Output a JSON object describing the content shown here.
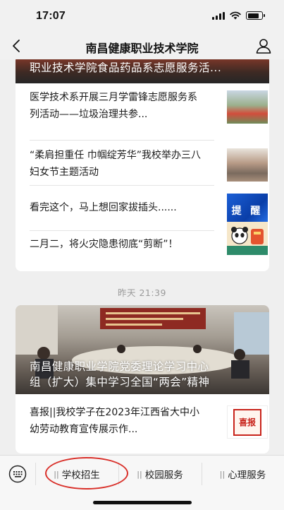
{
  "status_bar": {
    "time": "17:07",
    "battery_level": 0.8
  },
  "nav": {
    "title": "南昌健康职业技术学院"
  },
  "card1": {
    "hero_title": "职业技术学院食品药品系志愿服务活...",
    "items": [
      {
        "text": "医学技术系开展三月学雷锋志愿服务系列活动——垃圾治理共参..."
      },
      {
        "text": "“柔肩担重任 巾帼绽芳华”我校举办三八妇女节主题活动"
      },
      {
        "text": "看完这个，马上想回家拔插头......",
        "thumb_text": "提 醒"
      },
      {
        "text": "二月二，将火灾隐患彻底“剪断”！"
      }
    ]
  },
  "timestamp": "昨天 21:39",
  "card2": {
    "hero_title_line1": "南昌健康职业学院党委理论学习中心",
    "hero_title_line2": "组（扩大）集中学习全国“两会”精神",
    "items": [
      {
        "text": "喜报||我校学子在2023年江西省大中小幼劳动教育宣传展示作...",
        "thumb_text": "喜报"
      }
    ]
  },
  "menu": {
    "items": [
      {
        "label": "学校招生"
      },
      {
        "label": "校园服务"
      },
      {
        "label": "心理服务"
      }
    ]
  },
  "colors": {
    "annotation": "#d9302a",
    "hero_red": "#8b3a2a"
  }
}
